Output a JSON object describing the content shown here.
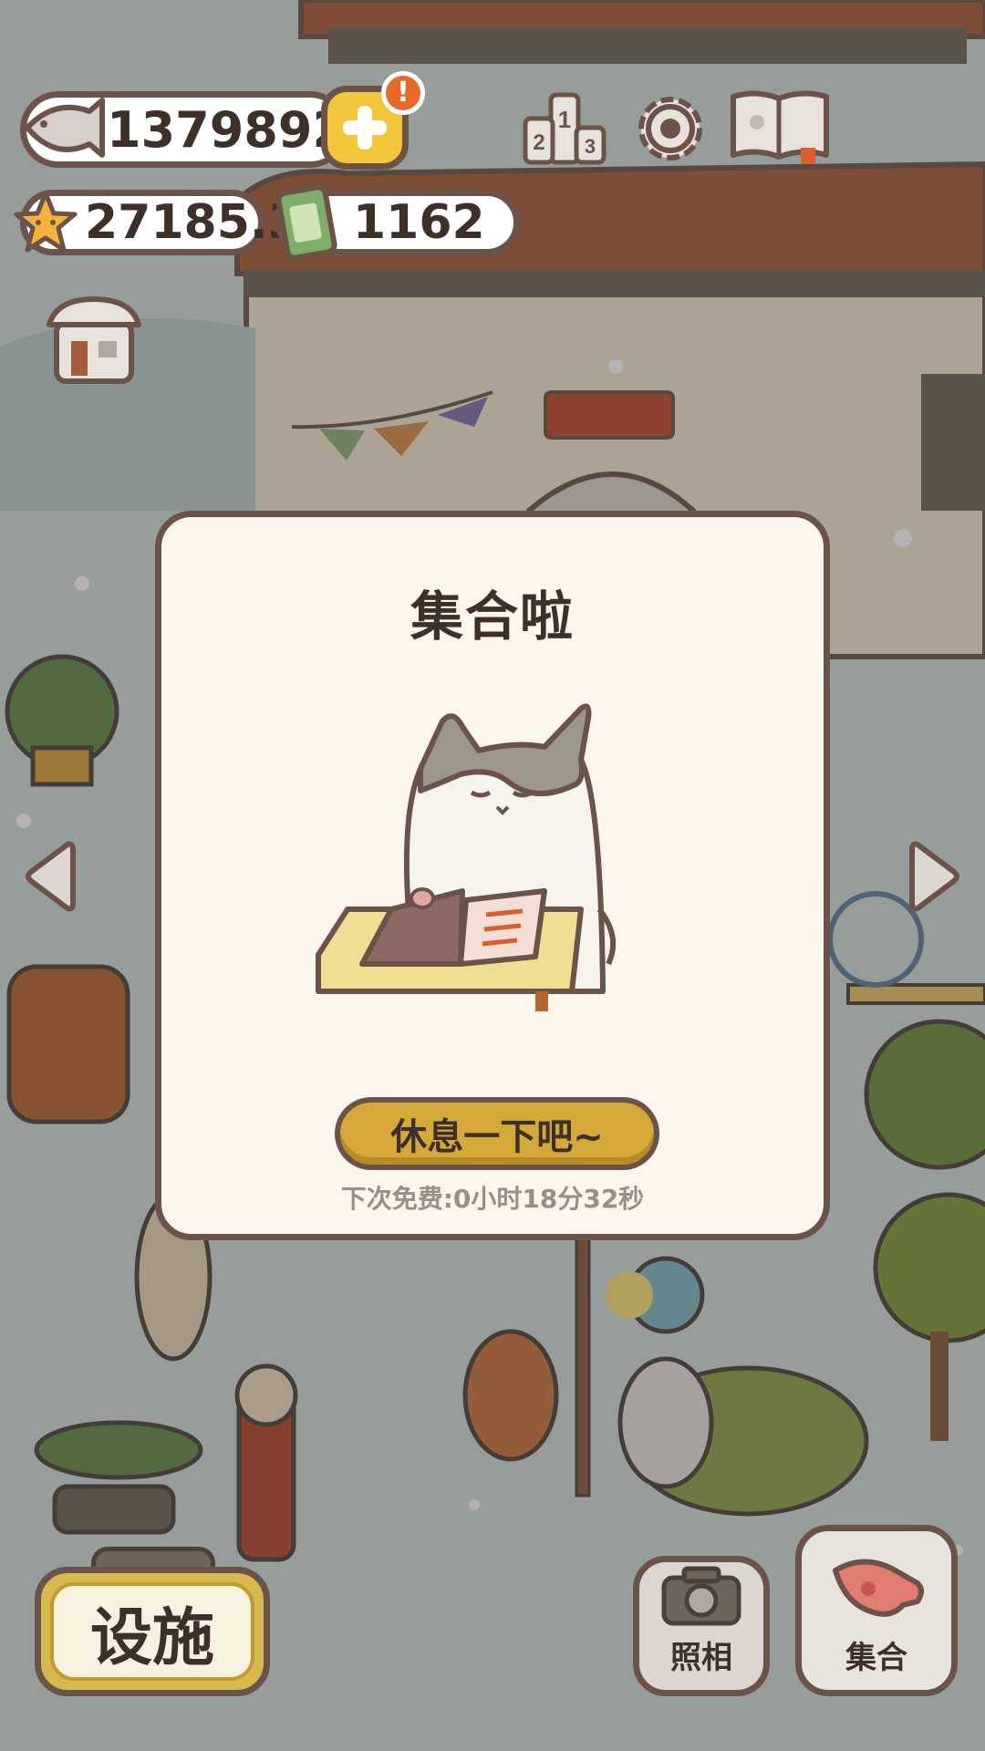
{
  "hud": {
    "fish_count": "13798923",
    "star_count": "27185.3",
    "card_count": "1162",
    "alert_badge": "!",
    "icons": [
      "fish-icon",
      "plus-icon",
      "star-icon",
      "card-icon",
      "podium-icon",
      "gear-icon",
      "book-icon",
      "shop-icon"
    ],
    "podium_digits": [
      "2",
      "1",
      "3"
    ]
  },
  "modal": {
    "title": "集合啦",
    "rest_button": "休息一下吧~",
    "free_timer": "下次免费:0小时18分32秒"
  },
  "bottom": {
    "facility_button": "设施",
    "photo_button": "照相",
    "gather_button": "集合"
  },
  "colors": {
    "outline": "#6b5349",
    "accent_yellow": "#d4a93a",
    "modal_bg": "#fcf6ec",
    "alert": "#e46a2b"
  }
}
